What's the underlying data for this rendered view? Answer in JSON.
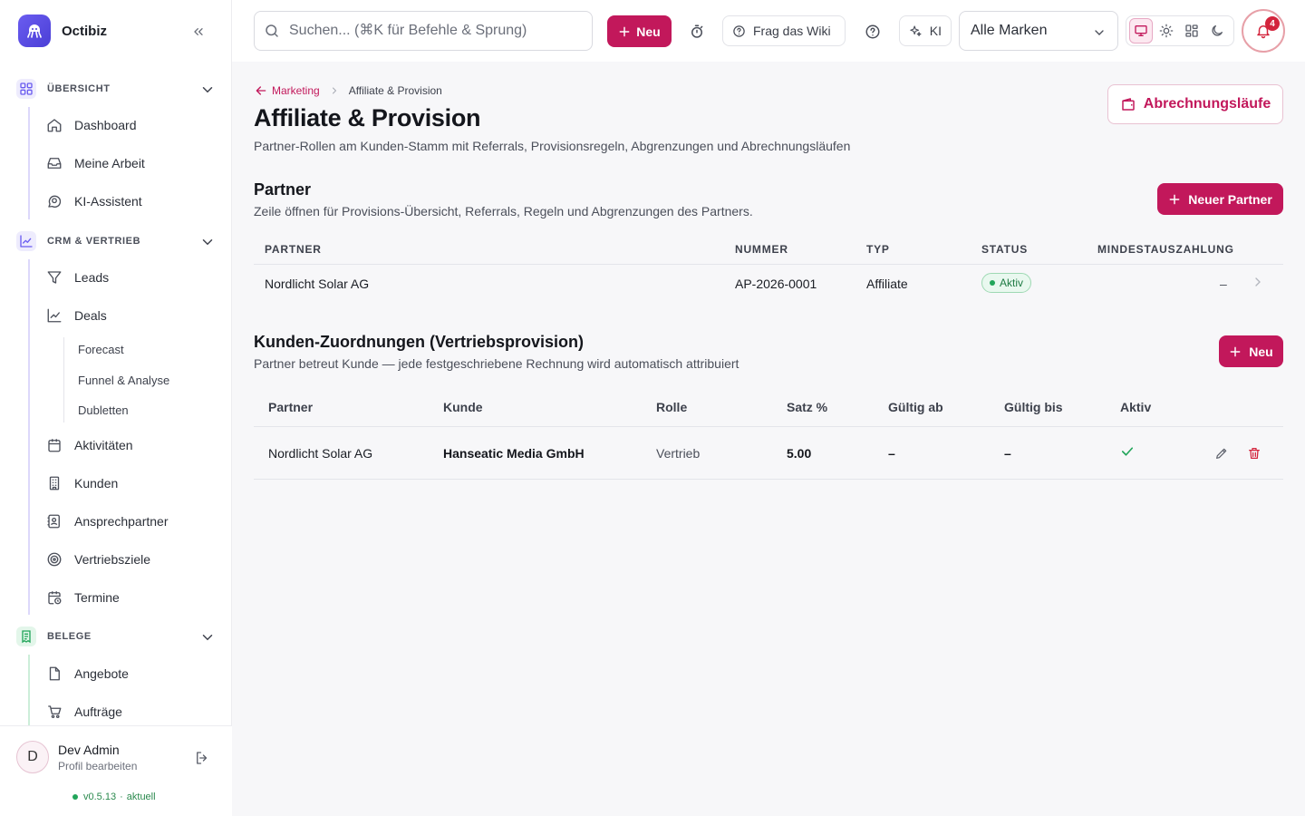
{
  "app": {
    "name": "Octibiz"
  },
  "sidebar": {
    "sections": [
      {
        "label": "ÜBERSICHT",
        "icon": "grid-icon",
        "color": "#6a5cf0"
      },
      {
        "label": "CRM & VERTRIEB",
        "icon": "chart-line-icon",
        "color": "#6a5cf0"
      },
      {
        "label": "BELEGE",
        "icon": "receipt-icon",
        "color": "#22a55a"
      }
    ],
    "items": {
      "dashboard": "Dashboard",
      "meine_arbeit": "Meine Arbeit",
      "ki_assistent": "KI-Assistent",
      "leads": "Leads",
      "deals": "Deals",
      "forecast": "Forecast",
      "funnel": "Funnel & Analyse",
      "dubletten": "Dubletten",
      "aktivitaeten": "Aktivitäten",
      "kunden": "Kunden",
      "ansprechpartner": "Ansprechpartner",
      "vertriebsziele": "Vertriebsziele",
      "termine": "Termine",
      "angebote": "Angebote",
      "auftraege": "Aufträge"
    },
    "user": {
      "initial": "D",
      "name": "Dev Admin",
      "subtitle": "Profil bearbeiten"
    },
    "version": {
      "number": "v0.5.13",
      "status": "aktuell"
    }
  },
  "topbar": {
    "search_placeholder": "Suchen... (⌘K für Befehle & Sprung)",
    "new_label": "Neu",
    "wiki_label": "Frag das Wiki",
    "ai_label": "KI",
    "brand_select": "Alle Marken",
    "notifications_count": "4"
  },
  "colors": {
    "accent": "#c2185b",
    "success": "#22a55a",
    "danger": "#d3243c",
    "brand": "#6a5cf0"
  },
  "page": {
    "breadcrumb_parent": "Marketing",
    "breadcrumb_current": "Affiliate & Provision",
    "title": "Affiliate & Provision",
    "subtitle": "Partner-Rollen am Kunden-Stamm mit Referrals, Provisionsregeln, Abgrenzungen und Abrechnungsläufen",
    "billing_runs_label": "Abrechnungsläufe"
  },
  "partners": {
    "title": "Partner",
    "subtitle": "Zeile öffnen für Provisions-Übersicht, Referrals, Regeln und Abgrenzungen des Partners.",
    "new_label": "Neuer Partner",
    "columns": [
      "PARTNER",
      "NUMMER",
      "TYP",
      "STATUS",
      "MINDESTAUSZAHLUNG"
    ],
    "rows": [
      {
        "partner": "Nordlicht Solar AG",
        "nummer": "AP-2026-0001",
        "typ": "Affiliate",
        "status": "Aktiv",
        "mindestauszahlung": "–"
      }
    ]
  },
  "assignments": {
    "title": "Kunden-Zuordnungen (Vertriebsprovision)",
    "subtitle": "Partner betreut Kunde — jede festgeschriebene Rechnung wird automatisch attribuiert",
    "new_label": "Neu",
    "columns": [
      "Partner",
      "Kunde",
      "Rolle",
      "Satz %",
      "Gültig ab",
      "Gültig bis",
      "Aktiv"
    ],
    "rows": [
      {
        "partner": "Nordlicht Solar AG",
        "kunde": "Hanseatic Media GmbH",
        "rolle": "Vertrieb",
        "satz": "5.00",
        "gueltig_ab": "–",
        "gueltig_bis": "–",
        "aktiv": "check-icon"
      }
    ]
  }
}
